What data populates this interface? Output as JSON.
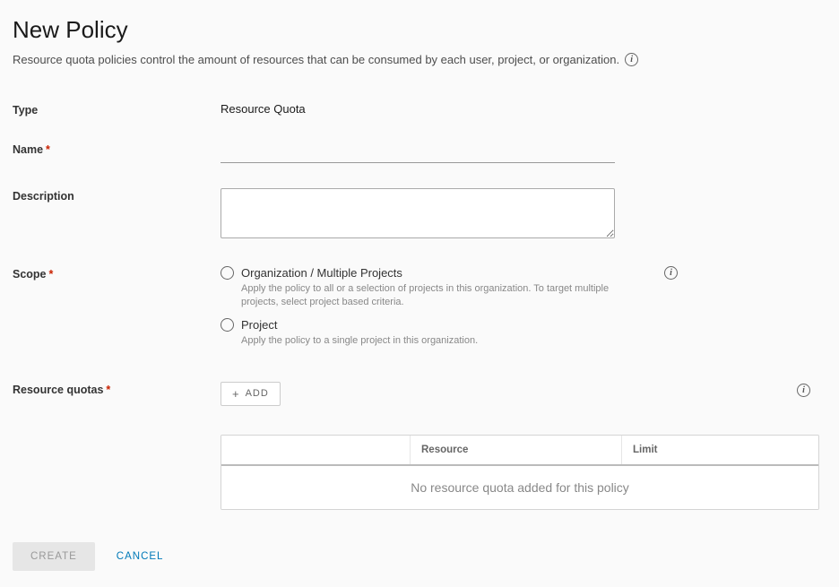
{
  "page": {
    "title": "New Policy",
    "subtitle": "Resource quota policies control the amount of resources that can be consumed by each user, project, or organization."
  },
  "form": {
    "type": {
      "label": "Type",
      "value": "Resource Quota"
    },
    "name": {
      "label": "Name",
      "value": ""
    },
    "description": {
      "label": "Description",
      "value": ""
    },
    "scope": {
      "label": "Scope",
      "options": [
        {
          "label": "Organization / Multiple Projects",
          "hint": "Apply the policy to all or a selection of projects in this organization. To target multiple projects, select project based criteria."
        },
        {
          "label": "Project",
          "hint": "Apply the policy to a single project in this organization."
        }
      ]
    },
    "quotas": {
      "label": "Resource quotas",
      "add_label": "ADD",
      "columns": {
        "resource": "Resource",
        "limit": "Limit"
      },
      "empty": "No resource quota added for this policy"
    }
  },
  "actions": {
    "create": "CREATE",
    "cancel": "CANCEL"
  }
}
